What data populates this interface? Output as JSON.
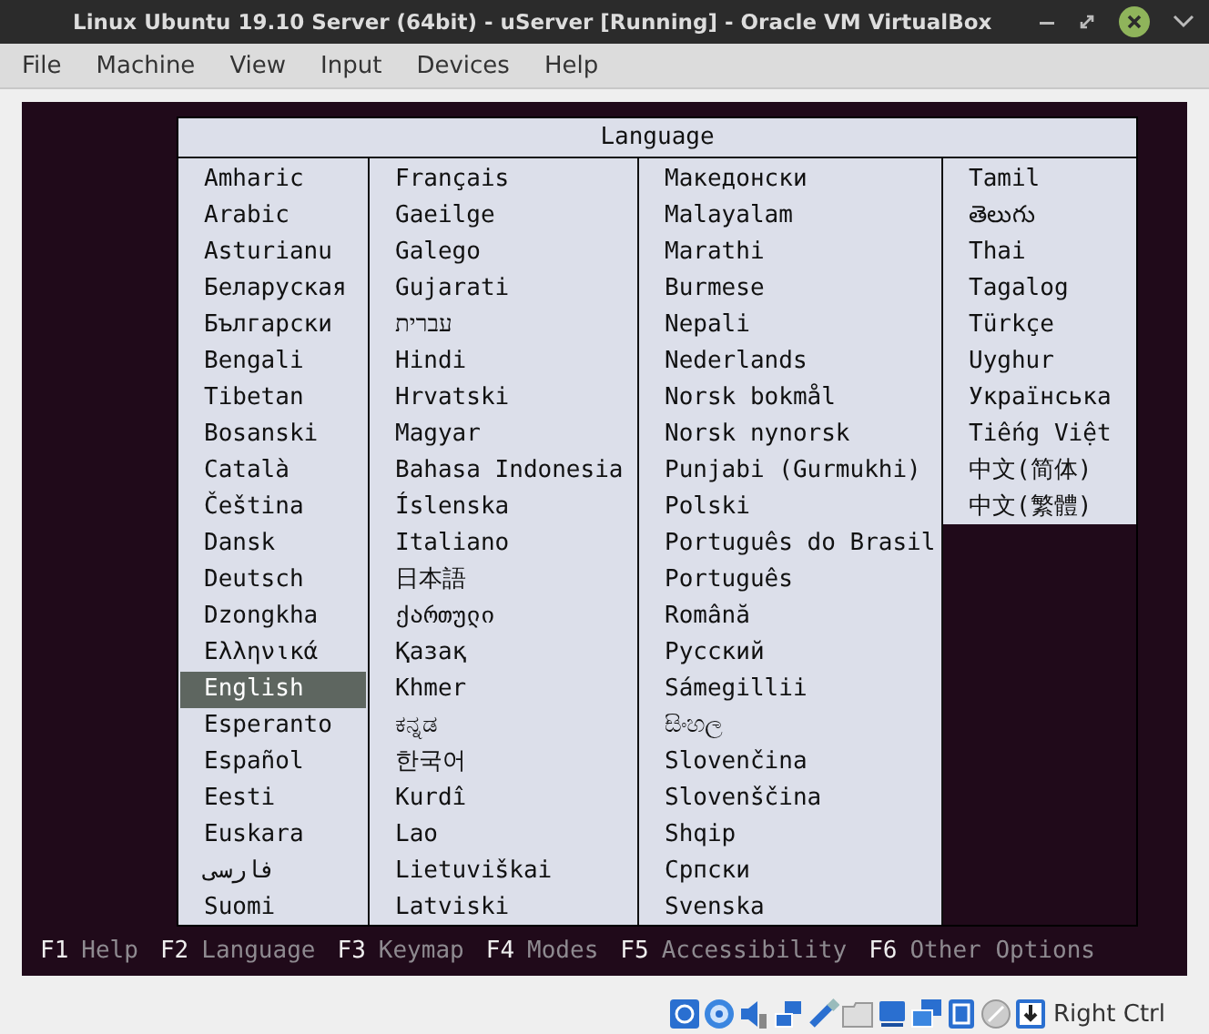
{
  "window": {
    "title": "Linux Ubuntu 19.10 Server (64bit) - uServer [Running] - Oracle VM VirtualBox"
  },
  "menu": [
    "File",
    "Machine",
    "View",
    "Input",
    "Devices",
    "Help"
  ],
  "language_dialog": {
    "title": "Language",
    "columns": [
      {
        "items": [
          {
            "label": "Amharic",
            "selected": false
          },
          {
            "label": "Arabic",
            "selected": false
          },
          {
            "label": "Asturianu",
            "selected": false
          },
          {
            "label": "Беларуская",
            "selected": false
          },
          {
            "label": "Български",
            "selected": false
          },
          {
            "label": "Bengali",
            "selected": false
          },
          {
            "label": "Tibetan",
            "selected": false
          },
          {
            "label": "Bosanski",
            "selected": false
          },
          {
            "label": "Català",
            "selected": false
          },
          {
            "label": "Čeština",
            "selected": false
          },
          {
            "label": "Dansk",
            "selected": false
          },
          {
            "label": "Deutsch",
            "selected": false
          },
          {
            "label": "Dzongkha",
            "selected": false
          },
          {
            "label": "Ελληνικά",
            "selected": false
          },
          {
            "label": "English",
            "selected": true
          },
          {
            "label": "Esperanto",
            "selected": false
          },
          {
            "label": "Español",
            "selected": false
          },
          {
            "label": "Eesti",
            "selected": false
          },
          {
            "label": "Euskara",
            "selected": false
          },
          {
            "label": "فارسی",
            "selected": false
          },
          {
            "label": "Suomi",
            "selected": false
          }
        ]
      },
      {
        "items": [
          {
            "label": "Français",
            "selected": false
          },
          {
            "label": "Gaeilge",
            "selected": false
          },
          {
            "label": "Galego",
            "selected": false
          },
          {
            "label": "Gujarati",
            "selected": false
          },
          {
            "label": "עברית",
            "selected": false
          },
          {
            "label": "Hindi",
            "selected": false
          },
          {
            "label": "Hrvatski",
            "selected": false
          },
          {
            "label": "Magyar",
            "selected": false
          },
          {
            "label": "Bahasa Indonesia",
            "selected": false
          },
          {
            "label": "Íslenska",
            "selected": false
          },
          {
            "label": "Italiano",
            "selected": false
          },
          {
            "label": "日本語",
            "selected": false
          },
          {
            "label": "ქართული",
            "selected": false
          },
          {
            "label": "Қазақ",
            "selected": false
          },
          {
            "label": "Khmer",
            "selected": false
          },
          {
            "label": "ಕನ್ನಡ",
            "selected": false
          },
          {
            "label": "한국어",
            "selected": false
          },
          {
            "label": "Kurdî",
            "selected": false
          },
          {
            "label": "Lao",
            "selected": false
          },
          {
            "label": "Lietuviškai",
            "selected": false
          },
          {
            "label": "Latviski",
            "selected": false
          }
        ]
      },
      {
        "items": [
          {
            "label": "Македонски",
            "selected": false
          },
          {
            "label": "Malayalam",
            "selected": false
          },
          {
            "label": "Marathi",
            "selected": false
          },
          {
            "label": "Burmese",
            "selected": false
          },
          {
            "label": "Nepali",
            "selected": false
          },
          {
            "label": "Nederlands",
            "selected": false
          },
          {
            "label": "Norsk bokmål",
            "selected": false
          },
          {
            "label": "Norsk nynorsk",
            "selected": false
          },
          {
            "label": "Punjabi (Gurmukhi)",
            "selected": false
          },
          {
            "label": "Polski",
            "selected": false
          },
          {
            "label": "Português do Brasil",
            "selected": false
          },
          {
            "label": "Português",
            "selected": false
          },
          {
            "label": "Română",
            "selected": false
          },
          {
            "label": "Русский",
            "selected": false
          },
          {
            "label": "Sámegillii",
            "selected": false
          },
          {
            "label": "සිංහල",
            "selected": false
          },
          {
            "label": "Slovenčina",
            "selected": false
          },
          {
            "label": "Slovenščina",
            "selected": false
          },
          {
            "label": "Shqip",
            "selected": false
          },
          {
            "label": "Српски",
            "selected": false
          },
          {
            "label": "Svenska",
            "selected": false
          }
        ]
      },
      {
        "items": [
          {
            "label": "Tamil",
            "selected": false
          },
          {
            "label": "తెలుగు",
            "selected": false
          },
          {
            "label": "Thai",
            "selected": false
          },
          {
            "label": "Tagalog",
            "selected": false
          },
          {
            "label": "Türkçe",
            "selected": false
          },
          {
            "label": "Uyghur",
            "selected": false
          },
          {
            "label": "Українська",
            "selected": false
          },
          {
            "label": "Tiếng Việt",
            "selected": false
          },
          {
            "label": "中文(简体)",
            "selected": false
          },
          {
            "label": "中文(繁體)",
            "selected": false
          }
        ]
      }
    ]
  },
  "function_keys": [
    {
      "key": "F1",
      "label": "Help"
    },
    {
      "key": "F2",
      "label": "Language"
    },
    {
      "key": "F3",
      "label": "Keymap"
    },
    {
      "key": "F4",
      "label": "Modes"
    },
    {
      "key": "F5",
      "label": "Accessibility"
    },
    {
      "key": "F6",
      "label": "Other Options"
    }
  ],
  "status_bar": {
    "host_key": "Right Ctrl"
  }
}
